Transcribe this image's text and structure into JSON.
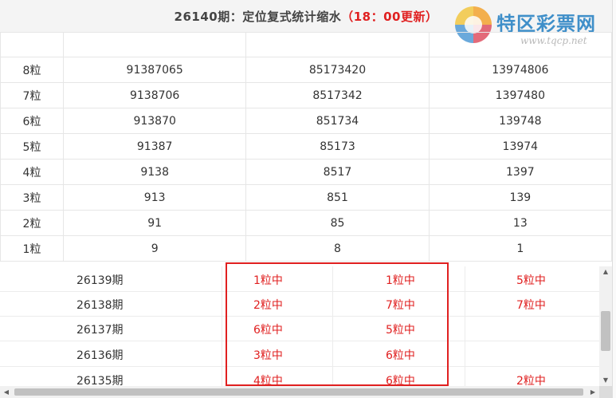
{
  "header": {
    "title": "26140期：定位复式统计缩水",
    "time": "（18：00更新）"
  },
  "logo": {
    "text": "特区彩票网",
    "url": "www.tqcp.net"
  },
  "stats_table": {
    "rows": [
      {
        "label": "8粒",
        "c1": "91387065",
        "c2": "85173420",
        "c3": "13974806"
      },
      {
        "label": "7粒",
        "c1": "9138706",
        "c2": "8517342",
        "c3": "1397480"
      },
      {
        "label": "6粒",
        "c1": "913870",
        "c2": "851734",
        "c3": "139748"
      },
      {
        "label": "5粒",
        "c1": "91387",
        "c2": "85173",
        "c3": "13974"
      },
      {
        "label": "4粒",
        "c1": "9138",
        "c2": "8517",
        "c3": "1397"
      },
      {
        "label": "3粒",
        "c1": "913",
        "c2": "851",
        "c3": "139"
      },
      {
        "label": "2粒",
        "c1": "91",
        "c2": "85",
        "c3": "13"
      },
      {
        "label": "1粒",
        "c1": "9",
        "c2": "8",
        "c3": "1"
      }
    ]
  },
  "history": {
    "rows": [
      {
        "period": "26139期",
        "c1": "1粒中",
        "c2": "1粒中",
        "c3": "5粒中"
      },
      {
        "period": "26138期",
        "c1": "2粒中",
        "c2": "7粒中",
        "c3": "7粒中"
      },
      {
        "period": "26137期",
        "c1": "6粒中",
        "c2": "5粒中",
        "c3": ""
      },
      {
        "period": "26136期",
        "c1": "3粒中",
        "c2": "6粒中",
        "c3": ""
      },
      {
        "period": "26135期",
        "c1": "4粒中",
        "c2": "6粒中",
        "c3": "2粒中"
      }
    ]
  },
  "scrollbar": {
    "up": "▲",
    "down": "▼",
    "left": "◀",
    "right": "▶"
  },
  "colors": {
    "accent": "#e02020",
    "logo": "#3f8fc9"
  }
}
